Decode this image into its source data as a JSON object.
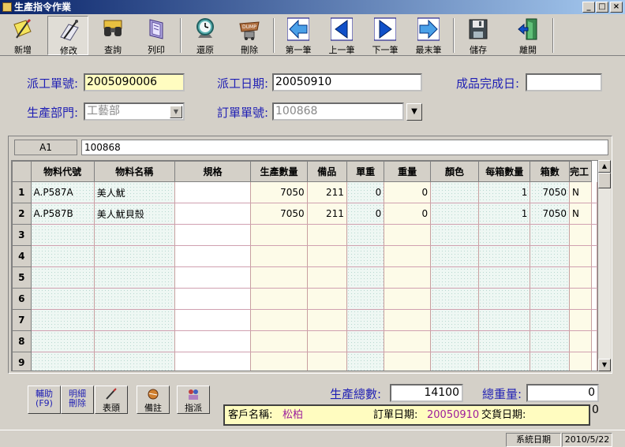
{
  "window": {
    "title": "生產指令作業",
    "min_glyph": "_",
    "max_glyph": "□",
    "close_glyph": "×"
  },
  "toolbar": [
    {
      "id": "new",
      "label": "新增",
      "icon": "sticky-note-pen-icon"
    },
    {
      "id": "edit",
      "label": "修改",
      "icon": "pen-paper-icon"
    },
    {
      "id": "query",
      "label": "查詢",
      "icon": "binoculars-icon"
    },
    {
      "id": "print",
      "label": "列印",
      "icon": "printer-book-icon"
    },
    {
      "id": "restore",
      "label": "還原",
      "icon": "clock-icon"
    },
    {
      "id": "delete",
      "label": "刪除",
      "icon": "dump-cart-icon",
      "icon_text": "DUMP"
    },
    {
      "id": "first",
      "label": "第一筆",
      "icon": "arrow-left-icon"
    },
    {
      "id": "prev",
      "label": "上一筆",
      "icon": "arrow-left-icon"
    },
    {
      "id": "next",
      "label": "下一筆",
      "icon": "arrow-right-icon"
    },
    {
      "id": "last",
      "label": "最末筆",
      "icon": "arrow-right-icon"
    },
    {
      "id": "save",
      "label": "儲存",
      "icon": "floppy-disk-icon"
    },
    {
      "id": "exit",
      "label": "離開",
      "icon": "exit-door-icon"
    }
  ],
  "form": {
    "order_no_label": "派工單號:",
    "order_no": "2005090006",
    "dispatch_date_label": "派工日期:",
    "dispatch_date": "20050910",
    "finish_date_label": "成品完成日:",
    "finish_date": "",
    "dept_label": "生產部門:",
    "dept": "工藝部",
    "sales_no_label": "訂單單號:",
    "sales_no": "100868"
  },
  "grid": {
    "cell_ref": "A1",
    "cell_value": "100868",
    "columns": [
      "物料代號",
      "物料名稱",
      "規格",
      "生產數量",
      "備品",
      "單重",
      "重量",
      "顏色",
      "每箱數量",
      "箱數",
      "完工"
    ],
    "rows": [
      {
        "no": "1",
        "cells": [
          "A.P587A",
          "美人魷",
          "",
          "7050",
          "211",
          "0",
          "0",
          "",
          "1",
          "7050",
          "N"
        ]
      },
      {
        "no": "2",
        "cells": [
          "A.P587B",
          "美人魷貝殼",
          "",
          "7050",
          "211",
          "0",
          "0",
          "",
          "1",
          "7050",
          "N"
        ]
      },
      {
        "no": "3",
        "cells": [
          "",
          "",
          "",
          "",
          "",
          "",
          "",
          "",
          "",
          "",
          ""
        ]
      },
      {
        "no": "4",
        "cells": [
          "",
          "",
          "",
          "",
          "",
          "",
          "",
          "",
          "",
          "",
          ""
        ]
      },
      {
        "no": "5",
        "cells": [
          "",
          "",
          "",
          "",
          "",
          "",
          "",
          "",
          "",
          "",
          ""
        ]
      },
      {
        "no": "6",
        "cells": [
          "",
          "",
          "",
          "",
          "",
          "",
          "",
          "",
          "",
          "",
          ""
        ]
      },
      {
        "no": "7",
        "cells": [
          "",
          "",
          "",
          "",
          "",
          "",
          "",
          "",
          "",
          "",
          ""
        ]
      },
      {
        "no": "8",
        "cells": [
          "",
          "",
          "",
          "",
          "",
          "",
          "",
          "",
          "",
          "",
          ""
        ]
      },
      {
        "no": "9",
        "cells": [
          "",
          "",
          "",
          "",
          "",
          "",
          "",
          "",
          "",
          "",
          ""
        ]
      }
    ]
  },
  "bottom_buttons": {
    "assist_line1": "輔助",
    "assist_line2": "(F9)",
    "del_detail_line1": "明細",
    "del_detail_line2": "刪除",
    "change_head": "表頭",
    "note": "備註",
    "assign": "指派"
  },
  "totals": {
    "qty_label": "生產總數:",
    "qty": "14100",
    "weight_label": "總重量:",
    "weight": "0",
    "weight2": "0"
  },
  "info": {
    "customer_label": "客戶名稱:",
    "customer": "松柏",
    "order_date_label": "訂單日期:",
    "order_date": "20050910",
    "delivery_label": "交貨日期:",
    "delivery": ""
  },
  "status": {
    "sys_date_label": "系統日期",
    "sys_date": "2010/5/22"
  },
  "colors": {
    "label_blue": "#1f1fb4",
    "value_purple": "#9c1c9c",
    "field_yellow": "#fffcc0"
  }
}
